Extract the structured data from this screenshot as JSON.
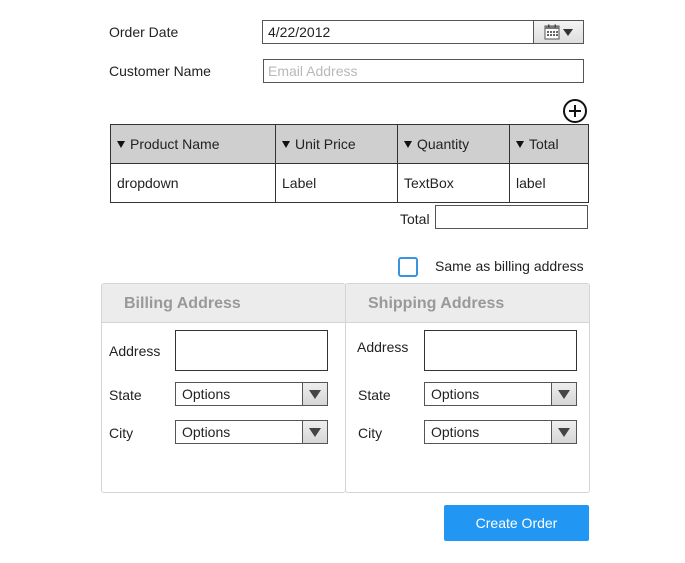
{
  "order_date": {
    "label": "Order Date",
    "value": "4/22/2012",
    "calendar_icon": "calendar-icon"
  },
  "customer": {
    "label": "Customer Name",
    "placeholder": "Email Address",
    "value": ""
  },
  "add_row_icon": "plus-circle-icon",
  "table": {
    "columns": [
      "Product Name",
      "Unit Price",
      "Quantity",
      "Total"
    ],
    "rows": [
      [
        "dropdown",
        "Label",
        "TextBox",
        "label"
      ]
    ]
  },
  "total": {
    "label": "Total",
    "value": ""
  },
  "same_as_billing": {
    "label": "Same as billing address",
    "checked": false
  },
  "billing": {
    "title": "Billing Address",
    "address_label": "Address",
    "state_label": "State",
    "state_value": "Options",
    "city_label": "City",
    "city_value": "Options"
  },
  "shipping": {
    "title": "Shipping Address",
    "address_label": "Address",
    "state_label": "State",
    "state_value": "Options",
    "city_label": "City",
    "city_value": "Options"
  },
  "create_button": "Create Order",
  "colors": {
    "accent": "#2196f3",
    "checkbox_border": "#3a93de",
    "table_header": "#cfcfcf",
    "panel_header": "#ececec"
  }
}
